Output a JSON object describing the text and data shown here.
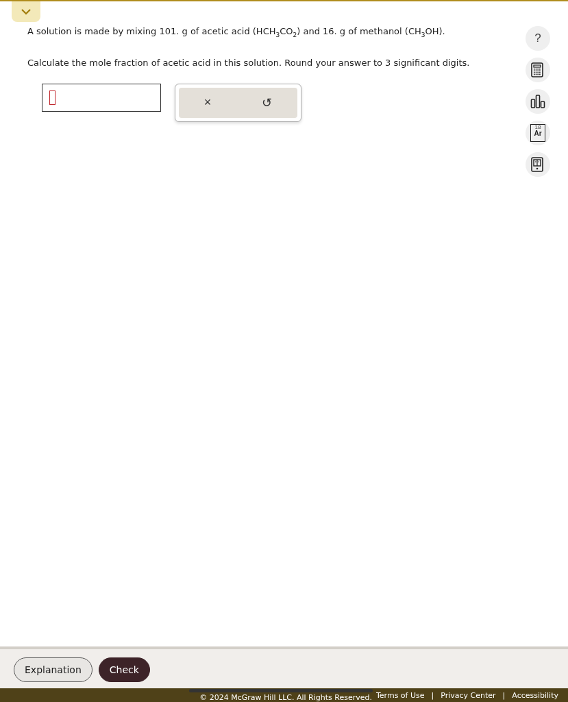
{
  "collapse_toggle": {
    "expanded": false
  },
  "question": [
    "A solution is made by mixing 101. g of acetic acid (HCH$_{3}$CO$_{2}$) and 16. g of methanol (CH$_{3}$OH).",
    "Calculate the mole fraction of acetic acid in this solution. Round your answer to 3 significant digits."
  ],
  "answer_tools": [
    "×",
    "↺"
  ],
  "side_tools": [
    {
      "kind": "help",
      "label": "?"
    },
    {
      "kind": "calculator"
    },
    {
      "kind": "chart"
    },
    {
      "kind": "periodic",
      "label": "Ar",
      "number": "18"
    },
    {
      "kind": "book"
    }
  ],
  "buttons": [
    {
      "kind": "secondary",
      "label": "Explanation"
    },
    {
      "kind": "primary",
      "label": "Check"
    }
  ],
  "footer": {
    "copyright": "© 2024 McGraw Hill LLC. All Rights Reserved.",
    "links": [
      "Terms of Use",
      "Privacy Center",
      "Accessibility"
    ],
    "separators": [
      "|",
      "|"
    ]
  }
}
